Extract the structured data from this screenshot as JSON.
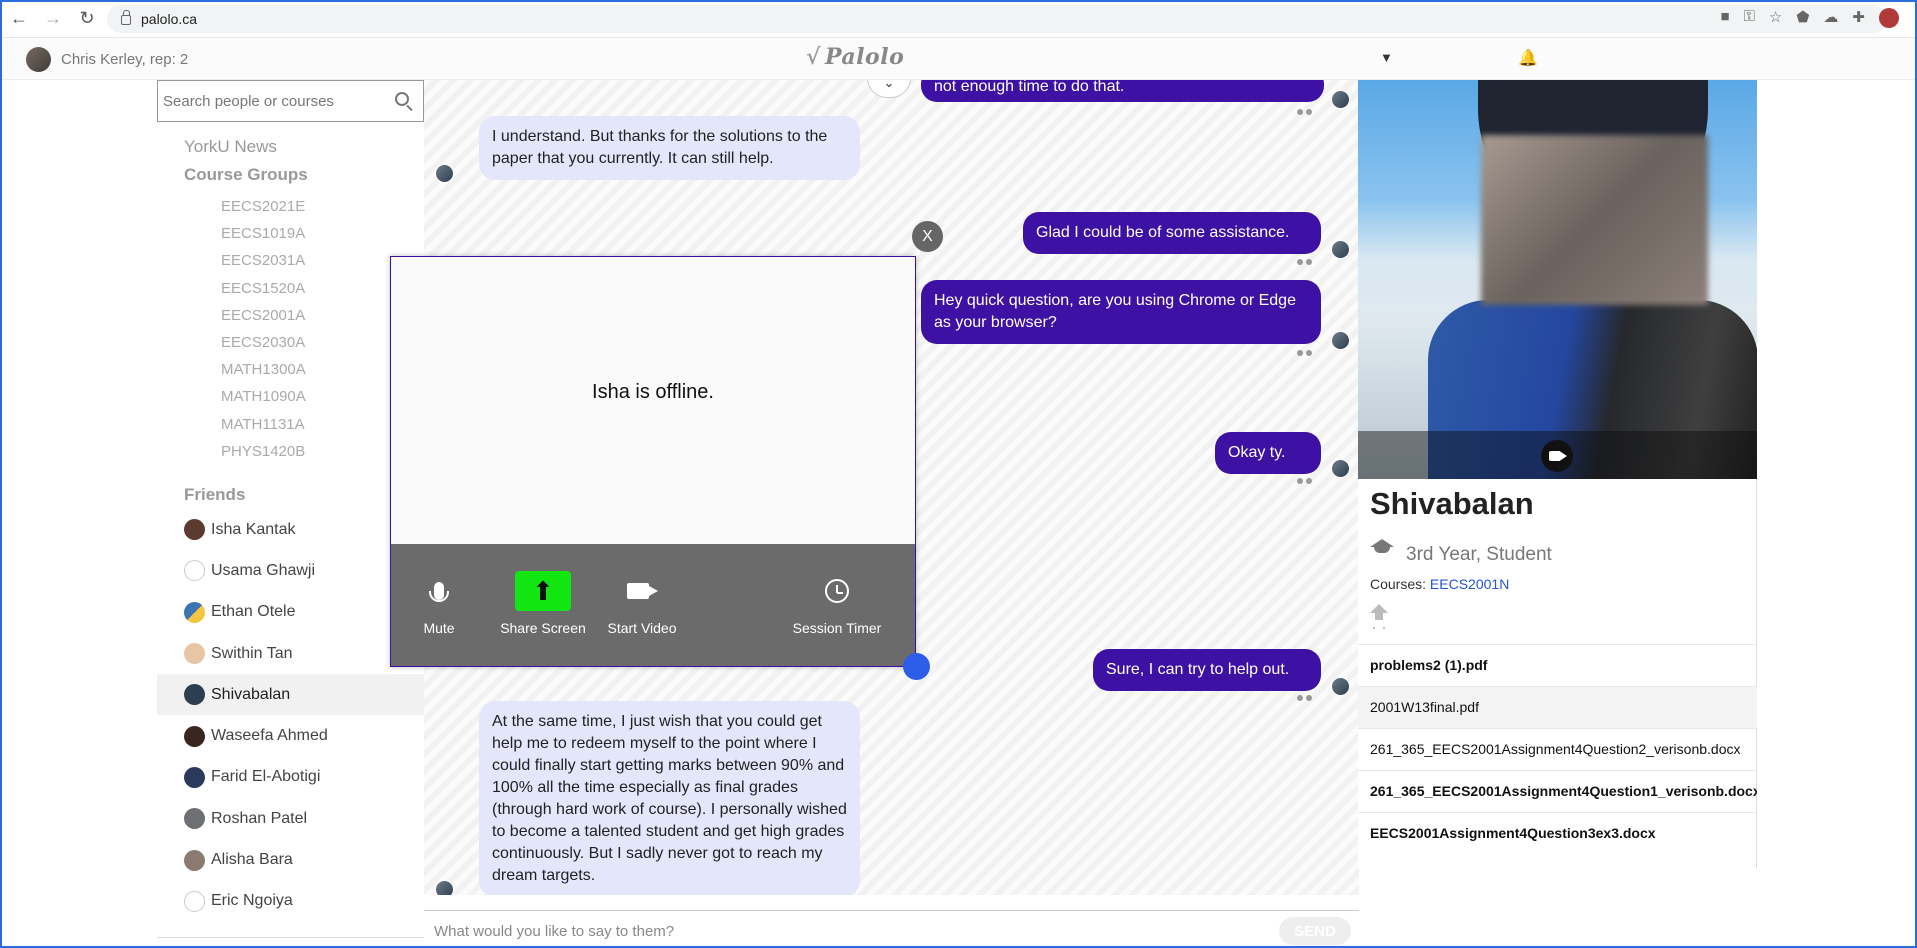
{
  "browser": {
    "url": "palolo.ca",
    "nav_back": "←",
    "nav_forward": "→",
    "reload": "↻",
    "icons": [
      "camera-icon",
      "key-icon",
      "star-icon",
      "shield-icon",
      "cloud-icon",
      "puzzle-icon",
      "profile-avatar"
    ]
  },
  "header": {
    "user": "Chris Kerley, rep: 2",
    "logo_mark": "√",
    "logo": "Palolo",
    "dropdown": "▼",
    "bell": "🔔"
  },
  "sidebar": {
    "search_placeholder": "Search people or courses",
    "news": "YorkU News",
    "groups_title": "Course Groups",
    "courses": [
      "EECS2021E",
      "EECS1019A",
      "EECS2031A",
      "EECS1520A",
      "EECS2001A",
      "EECS2030A",
      "MATH1300A",
      "MATH1090A",
      "MATH1131A",
      "PHYS1420B"
    ],
    "friends_title": "Friends",
    "friends": [
      {
        "name": "Isha Kantak",
        "color": "#5b3a2f"
      },
      {
        "name": "Usama Ghawji",
        "color": "#e6e6e6"
      },
      {
        "name": "Ethan Otele",
        "color": "#3c74b6"
      },
      {
        "name": "Swithin Tan",
        "color": "#e7c6a6"
      },
      {
        "name": "Shivabalan",
        "color": "#2c3e50"
      },
      {
        "name": "Waseefa Ahmed",
        "color": "#3a2620"
      },
      {
        "name": "Farid El-Abotigi",
        "color": "#2b3a5c"
      },
      {
        "name": "Roshan Patel",
        "color": "#6e6f73"
      },
      {
        "name": "Alisha Bara",
        "color": "#8a7a70"
      },
      {
        "name": "Eric Ngoiya",
        "color": "#e6e6e6"
      }
    ]
  },
  "chat": {
    "messages": {
      "m0": "not enough time to do that.",
      "m1": "I understand. But thanks for the solutions to the paper that you currently. It can still help.",
      "m2": "Glad I could be of some assistance.",
      "m3": "Hey quick question, are you using Chrome or Edge as your browser?",
      "m4": "Okay ty.",
      "m5": "Sure, I can try to help out.",
      "m6": "At the same time, I just wish that you could get help me to redeem myself to the point where I could finally start getting marks between 90% and 100% all the time especially as final grades (through hard work of course). I personally wished to become a talented student and get high grades continuously. But I sadly never got to reach my dream targets."
    },
    "input_placeholder": "What would you like to say to them?",
    "send_label": "SEND",
    "scroll_icon": "⌄"
  },
  "video_call": {
    "status": "Isha is offline.",
    "close_label": "X",
    "controls": {
      "mute": "Mute",
      "share": "Share Screen",
      "video": "Start Video",
      "timer": "Session Timer"
    }
  },
  "profile": {
    "name": "Shivabalan",
    "year": "3rd Year, Student",
    "courses_label": "Courses: ",
    "course": "EECS2001N",
    "files": [
      "problems2 (1).pdf",
      "2001W13final.pdf",
      "261_365_EECS2001Assignment4Question2_verisonb.docx",
      "261_365_EECS2001Assignment4Question1_verisonb.docx",
      "EECS2001Assignment4Question3ex3.docx"
    ]
  }
}
